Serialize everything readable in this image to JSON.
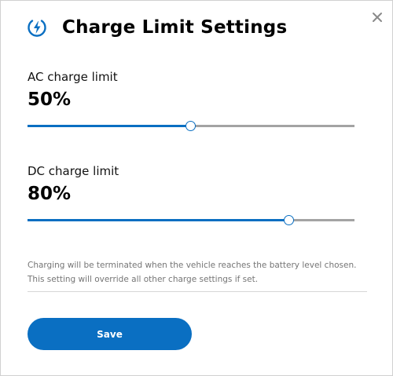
{
  "dialog": {
    "title": "Charge Limit Settings",
    "title_icon": "charging-bolt-icon",
    "close_icon": "close-icon"
  },
  "ac": {
    "label": "AC charge limit",
    "value_text": "50%",
    "level": 0.5
  },
  "dc": {
    "label": "DC charge limit",
    "value_text": "80%",
    "level": 0.8
  },
  "note": {
    "line1": "Charging will be terminated when the vehicle reaches the battery level chosen.",
    "line2": "This setting will override all other charge settings if set."
  },
  "save_label": "Save",
  "colors": {
    "accent": "#0a6fc2",
    "track": "#a3a3a3",
    "note": "#757575"
  }
}
